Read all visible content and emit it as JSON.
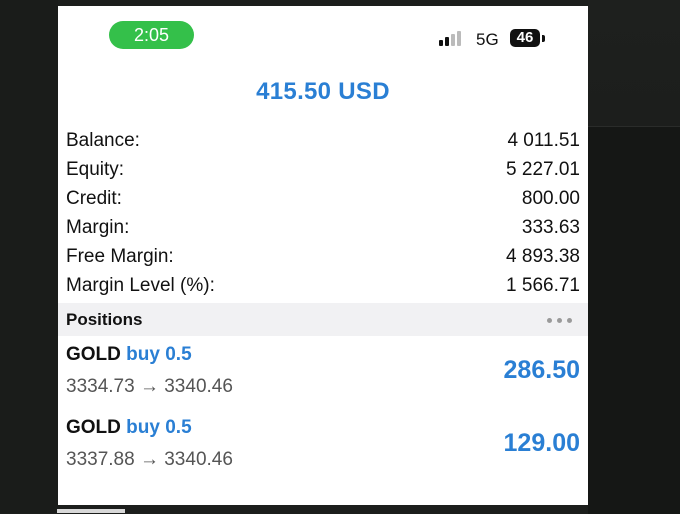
{
  "status_bar": {
    "time": "2:05",
    "network": "5G",
    "battery": "46"
  },
  "account": {
    "floating_profit": "415.50 USD",
    "rows": [
      {
        "label": "Balance:",
        "value": "4 011.51"
      },
      {
        "label": "Equity:",
        "value": "5 227.01"
      },
      {
        "label": "Credit:",
        "value": "800.00"
      },
      {
        "label": "Margin:",
        "value": "333.63"
      },
      {
        "label": "Free Margin:",
        "value": "4 893.38"
      },
      {
        "label": "Margin Level (%):",
        "value": "1 566.71"
      }
    ]
  },
  "positions": {
    "title": "Positions",
    "items": [
      {
        "symbol": "GOLD",
        "side_volume": "buy 0.5",
        "prices": "3334.73 → 3340.46",
        "profit": "286.50"
      },
      {
        "symbol": "GOLD",
        "side_volume": "buy 0.5",
        "prices": "3337.88 → 3340.46",
        "profit": "129.00"
      }
    ]
  },
  "colors": {
    "accent": "#2a7fd4",
    "time_pill": "#34c04a",
    "section_bg": "#f1f1f3"
  },
  "icons": {
    "more": "ellipsis-icon",
    "signal": "cellular-signal-icon",
    "battery": "battery-icon"
  }
}
